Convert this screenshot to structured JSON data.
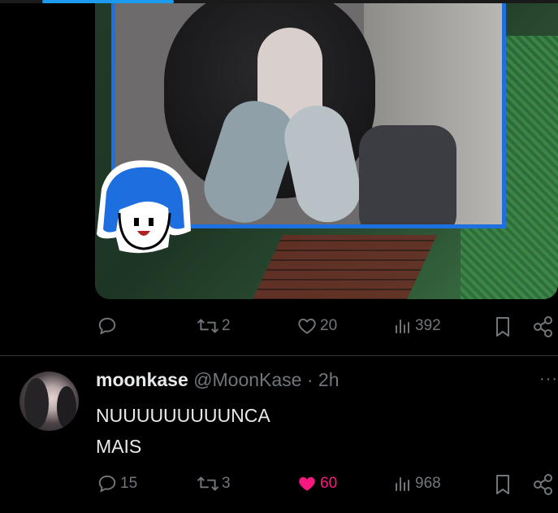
{
  "tweet1": {
    "actions": {
      "reply_count": "",
      "repost_count": "2",
      "like_count": "20",
      "views_count": "392"
    }
  },
  "tweet2": {
    "display_name": "moonkase",
    "handle": "@MoonKase",
    "separator": "·",
    "time": "2h",
    "more": "···",
    "text_line1": "NUUUUUUUUUNCA",
    "text_line2": "MAIS",
    "actions": {
      "reply_count": "15",
      "repost_count": "3",
      "like_count": "60",
      "views_count": "968",
      "liked": true
    }
  },
  "colors": {
    "accent": "#1d9bf0",
    "like": "#f91880",
    "muted": "#71767b",
    "text": "#e7e9ea",
    "background": "#000000"
  },
  "icons": [
    "reply-icon",
    "repost-icon",
    "like-icon",
    "views-icon",
    "bookmark-icon",
    "share-icon",
    "more-icon"
  ]
}
